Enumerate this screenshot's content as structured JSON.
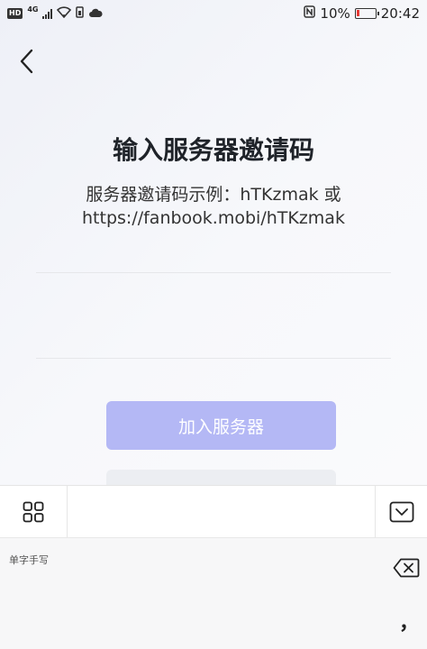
{
  "status_bar": {
    "network_badge": "HD",
    "network_type": "4G",
    "nfc_label": "N",
    "battery_percent": "10%",
    "time": "20:42"
  },
  "header": {
    "back_icon": "chevron-left-icon"
  },
  "main": {
    "title": "输入服务器邀请码",
    "hint_line1": "服务器邀请码示例：hTKzmak 或",
    "hint_line2": "https://fanbook.mobi/hTKzmak",
    "input_value": "",
    "join_button_label": "加入服务器",
    "join_button_color": "#b4b8f5"
  },
  "keyboard": {
    "grid_icon": "grid-icon",
    "collapse_icon": "keyboard-collapse-icon",
    "mode_label": "单字手写",
    "delete_icon": "backspace-icon",
    "comma_key": "，"
  }
}
